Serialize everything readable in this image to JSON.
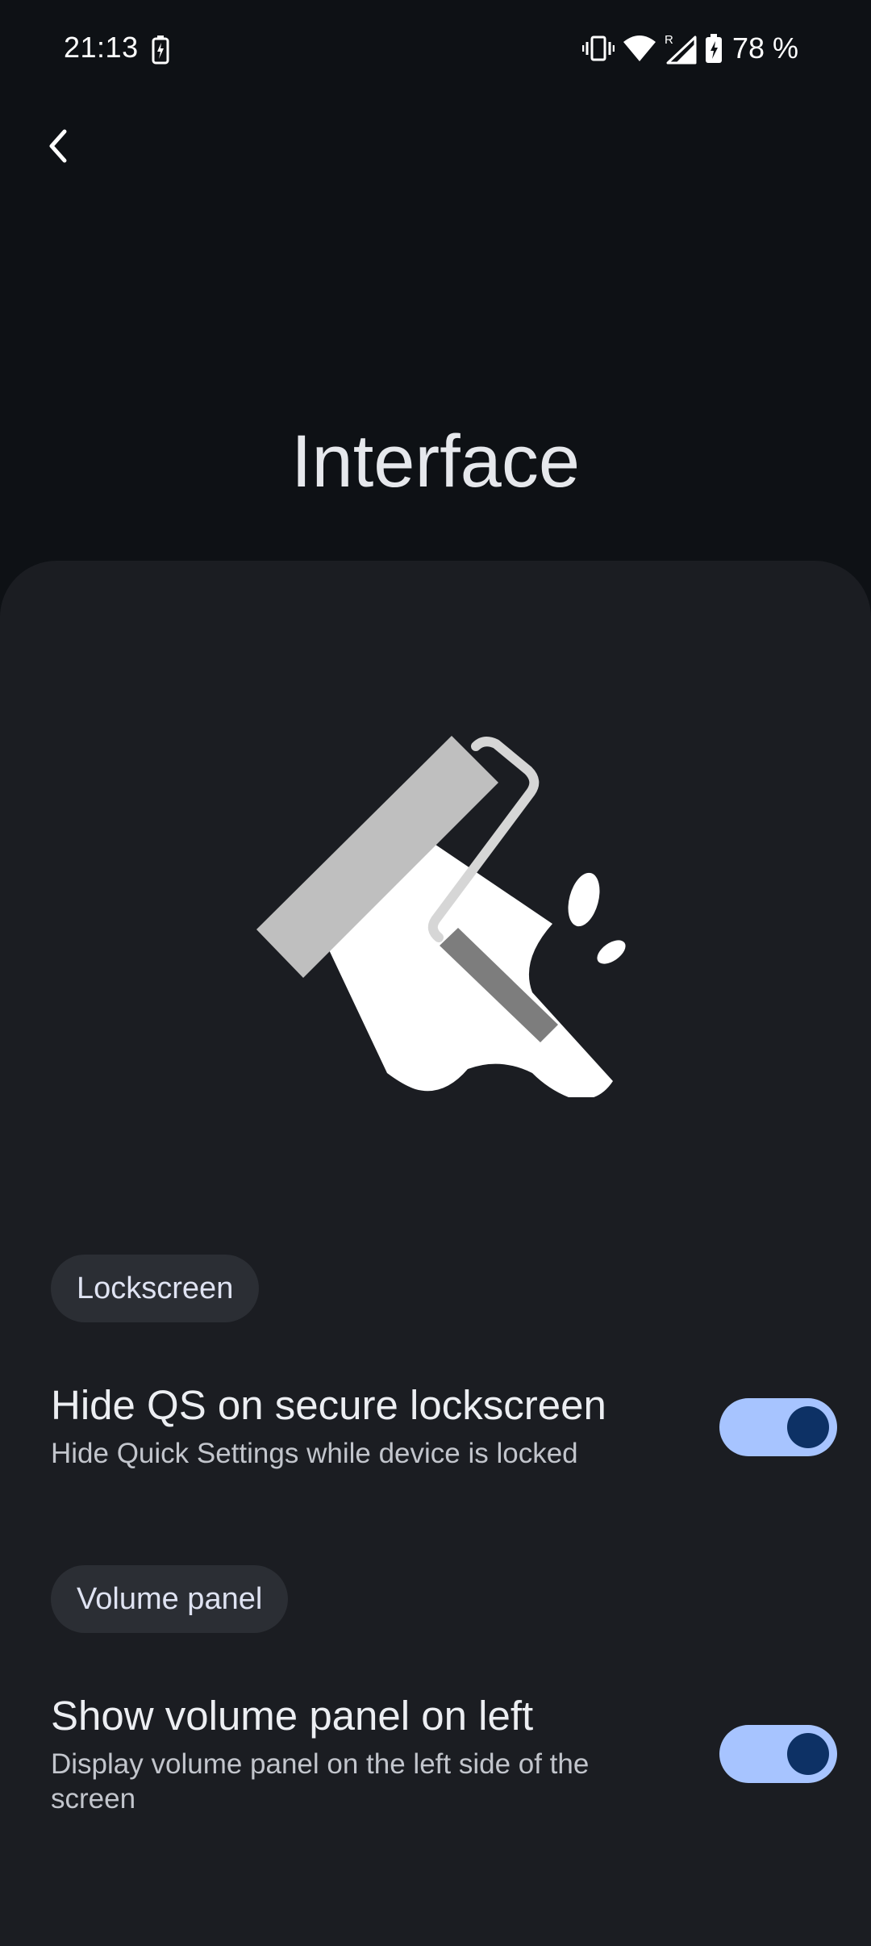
{
  "status_bar": {
    "time": "21:13",
    "battery_percent": "78 %",
    "icons": [
      "battery-saver-icon",
      "vibrate-icon",
      "wifi-icon",
      "signal-roaming-icon",
      "battery-charging-icon"
    ]
  },
  "header": {
    "back_icon": "chevron-left-icon",
    "title": "Interface"
  },
  "illustration": {
    "icon": "paint-roller-icon"
  },
  "sections": [
    {
      "label": "Lockscreen",
      "settings": [
        {
          "title": "Hide QS on secure lockscreen",
          "description": "Hide Quick Settings while device is locked",
          "enabled": true
        }
      ]
    },
    {
      "label": "Volume panel",
      "settings": [
        {
          "title": "Show volume panel on left",
          "description": "Display volume panel on the left side of the screen",
          "enabled": true
        }
      ]
    }
  ],
  "colors": {
    "background": "#0e1115",
    "card": "#1b1d22",
    "chip": "#2b2e34",
    "toggle_track_on": "#a7c4ff",
    "toggle_thumb_on": "#0d3165"
  }
}
